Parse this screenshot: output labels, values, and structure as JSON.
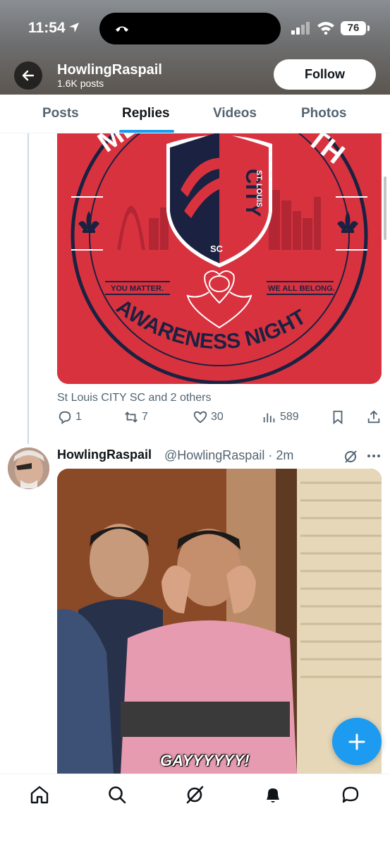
{
  "status_bar": {
    "time": "11:54",
    "battery": "76"
  },
  "profile": {
    "name": "HowlingRaspail",
    "posts": "1.6K posts",
    "follow_label": "Follow"
  },
  "tabs": [
    {
      "label": "Posts"
    },
    {
      "label": "Replies"
    },
    {
      "label": "Videos"
    },
    {
      "label": "Photos"
    }
  ],
  "active_tab": "Replies",
  "post1": {
    "media_text": {
      "arc_top": "M       TH",
      "crest_city": "CITY",
      "crest_stlouis": "ST. LOUIS",
      "crest_sc": "SC",
      "left_tagline": "YOU MATTER.",
      "right_tagline": "WE ALL BELONG.",
      "bottom_arc": "AWARENESS NIGHT"
    },
    "credits": "St Louis CITY SC and 2 others",
    "stats": {
      "replies": "1",
      "reposts": "7",
      "likes": "30",
      "views": "589"
    }
  },
  "post2": {
    "name": "HowlingRaspail",
    "handle_time": "@HowlingRaspail · 2m",
    "gif_caption": "GAYYYYYY!"
  },
  "colors": {
    "accent": "#1d9bf0",
    "badge_red": "#d9323f",
    "badge_navy": "#1b2140"
  }
}
